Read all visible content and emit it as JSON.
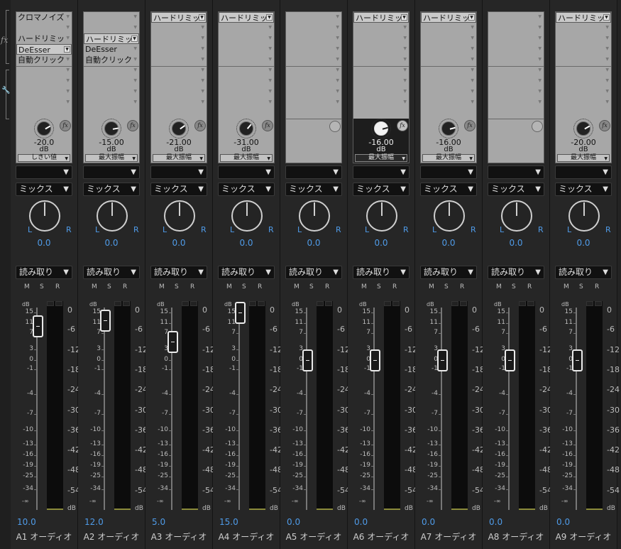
{
  "sidebar": {
    "fx_label": "fx",
    "wrench_icon": "wrench-icon"
  },
  "labels": {
    "mute": "M",
    "solo": "S",
    "record": "R",
    "pan_left": "L",
    "pan_right": "R",
    "db": "dB",
    "inf": "-∞",
    "send_unit": "dB"
  },
  "fader_scale": [
    "15",
    "11",
    "7",
    "3",
    "0",
    "-1",
    "-4",
    "-7",
    "-10",
    "-13",
    "-16",
    "-19",
    "-25",
    "-34"
  ],
  "meter_scale": [
    "0",
    "-6",
    "-12",
    "-18",
    "-24",
    "-30",
    "-36",
    "-42",
    "-48",
    "-54"
  ],
  "tracks": [
    {
      "name": "A1 オーディオ",
      "volume": "10.0",
      "fader_db": 10.0,
      "pan": "0.0",
      "effects": [
        "クロマノイズ",
        "",
        "ハードリミッ",
        "DeEsser",
        "自動クリック"
      ],
      "selected_slot": 3,
      "send": {
        "value": "-20.0",
        "param": "しきい値",
        "active": false,
        "empty": false
      },
      "output": "",
      "mode": "ミックス",
      "automation": "読み取り"
    },
    {
      "name": "A2 オーディオ",
      "volume": "12.0",
      "fader_db": 12.0,
      "pan": "0.0",
      "effects": [
        "",
        "",
        "ハードリミッ",
        "DeEsser",
        "自動クリック"
      ],
      "selected_slot": 2,
      "send": {
        "value": "-15.00",
        "param": "最大振幅",
        "active": false,
        "empty": false
      },
      "output": "",
      "mode": "ミックス",
      "automation": "読み取り"
    },
    {
      "name": "A3 オーディオ",
      "volume": "5.0",
      "fader_db": 5.0,
      "pan": "0.0",
      "effects": [
        "ハードリミッ"
      ],
      "selected_slot": 0,
      "send": {
        "value": "-21.00",
        "param": "最大振幅",
        "active": false,
        "empty": false
      },
      "output": "",
      "mode": "ミックス",
      "automation": "読み取り"
    },
    {
      "name": "A4 オーディオ",
      "volume": "15.0",
      "fader_db": 15.0,
      "pan": "0.0",
      "effects": [
        "ハードリミッ"
      ],
      "selected_slot": 0,
      "send": {
        "value": "-31.00",
        "param": "最大振幅",
        "active": false,
        "empty": false
      },
      "output": "",
      "mode": "ミックス",
      "automation": "読み取り"
    },
    {
      "name": "A5 オーディオ",
      "volume": "0.0",
      "fader_db": 0.0,
      "pan": "0.0",
      "effects": [],
      "selected_slot": -1,
      "send": {
        "value": "",
        "param": "",
        "active": false,
        "empty": true
      },
      "output": "",
      "mode": "ミックス",
      "automation": "読み取り"
    },
    {
      "name": "A6 オーディオ",
      "volume": "0.0",
      "fader_db": 0.0,
      "pan": "0.0",
      "effects": [
        "ハードリミッ"
      ],
      "selected_slot": 0,
      "send": {
        "value": "-16.00",
        "param": "最大振幅",
        "active": true,
        "empty": false
      },
      "output": "",
      "mode": "ミックス",
      "automation": "読み取り"
    },
    {
      "name": "A7 オーディオ",
      "volume": "0.0",
      "fader_db": 0.0,
      "pan": "0.0",
      "effects": [
        "ハードリミッ"
      ],
      "selected_slot": 0,
      "send": {
        "value": "-16.00",
        "param": "最大振幅",
        "active": false,
        "empty": false
      },
      "output": "",
      "mode": "ミックス",
      "automation": "読み取り"
    },
    {
      "name": "A8 オーディオ",
      "volume": "0.0",
      "fader_db": 0.0,
      "pan": "0.0",
      "effects": [],
      "selected_slot": -1,
      "send": {
        "value": "",
        "param": "",
        "active": false,
        "empty": true
      },
      "output": "",
      "mode": "ミックス",
      "automation": "読み取り"
    },
    {
      "name": "A9 オーディオ",
      "volume": "0.0",
      "fader_db": 0.0,
      "pan": "0.0",
      "effects": [
        "ハードリミッ"
      ],
      "selected_slot": 0,
      "send": {
        "value": "-20.00",
        "param": "最大振幅",
        "active": false,
        "empty": false
      },
      "output": "",
      "mode": "ミックス",
      "automation": "読み取り"
    }
  ],
  "colors": {
    "accent": "#4f9be8",
    "panel": "#262626",
    "rack": "#a7a7a7"
  }
}
